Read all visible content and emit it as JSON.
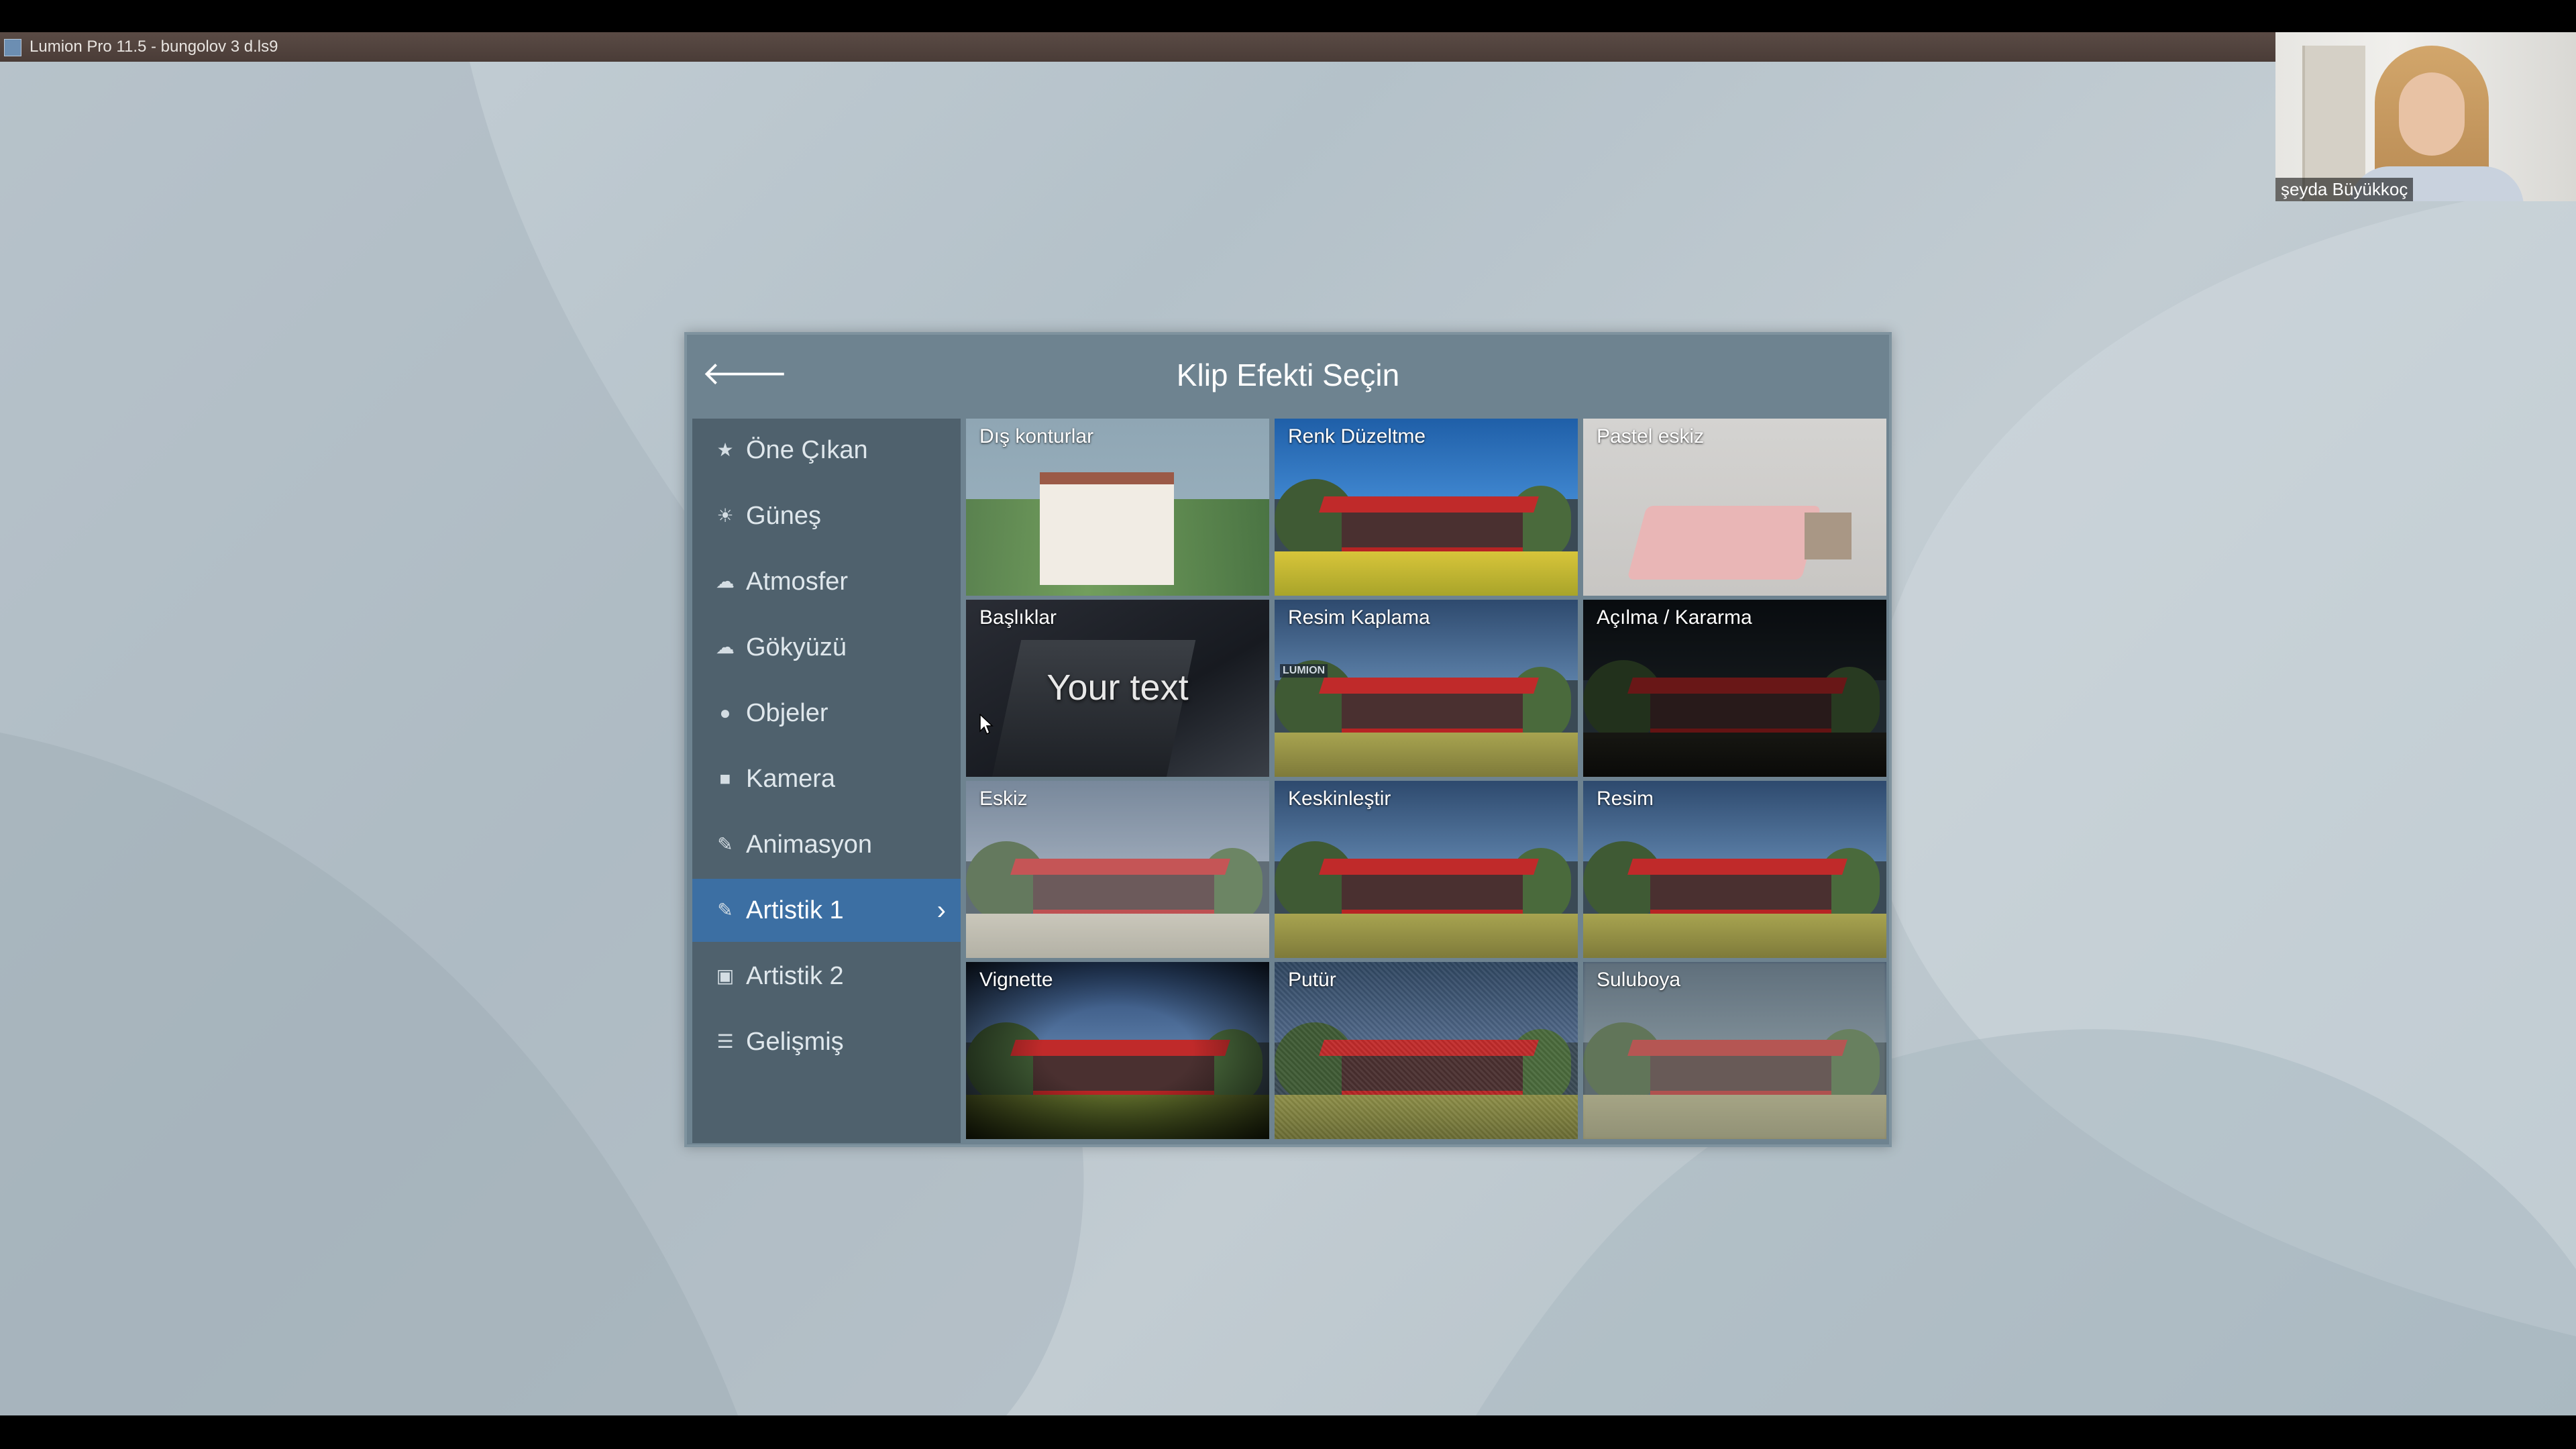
{
  "window": {
    "title": "Lumion Pro 11.5  - bungolov 3 d.ls9"
  },
  "webcam": {
    "name": "şeyda Büyükkoç"
  },
  "dialog": {
    "title": "Klip Efekti Seçin",
    "back_icon": "back-arrow-icon"
  },
  "sidebar": {
    "items": [
      {
        "label": "Öne Çıkan",
        "icon": "star-icon",
        "glyph": "★"
      },
      {
        "label": "Güneş",
        "icon": "sun-icon",
        "glyph": "☀"
      },
      {
        "label": "Atmosfer",
        "icon": "atmosphere-icon",
        "glyph": "☁"
      },
      {
        "label": "Gökyüzü",
        "icon": "cloud-icon",
        "glyph": "☁"
      },
      {
        "label": "Objeler",
        "icon": "circle-icon",
        "glyph": "●"
      },
      {
        "label": "Kamera",
        "icon": "camera-icon",
        "glyph": "■"
      },
      {
        "label": "Animasyon",
        "icon": "brush-icon",
        "glyph": "✎"
      },
      {
        "label": "Artistik 1",
        "icon": "pencil-icon",
        "glyph": "✎",
        "active": true
      },
      {
        "label": "Artistik 2",
        "icon": "image-icon",
        "glyph": "▣"
      },
      {
        "label": "Gelişmiş",
        "icon": "sliders-icon",
        "glyph": "☰"
      }
    ]
  },
  "effects": [
    {
      "label": "Dış konturlar",
      "style": "dis"
    },
    {
      "label": "Renk Düzeltme",
      "style": "vivid"
    },
    {
      "label": "Pastel eskiz",
      "style": "pastel"
    },
    {
      "label": "Başlıklar",
      "style": "title",
      "overlay_text": "Your text"
    },
    {
      "label": "Resim Kaplama",
      "style": "house",
      "badge": "LUMION"
    },
    {
      "label": "Açılma / Kararma",
      "style": "dark"
    },
    {
      "label": "Eskiz",
      "style": "sketch"
    },
    {
      "label": "Keskinleştir",
      "style": "house"
    },
    {
      "label": "Resim",
      "style": "house"
    },
    {
      "label": "Vignette",
      "style": "vignette"
    },
    {
      "label": "Putür",
      "style": "noise"
    },
    {
      "label": "Suluboya",
      "style": "watercolor"
    }
  ],
  "colors": {
    "active_item": "#3c6fa3",
    "sidebar_bg": "#4f616d",
    "dialog_bg": "#6e8390",
    "roof_red": "#c02a2a"
  }
}
